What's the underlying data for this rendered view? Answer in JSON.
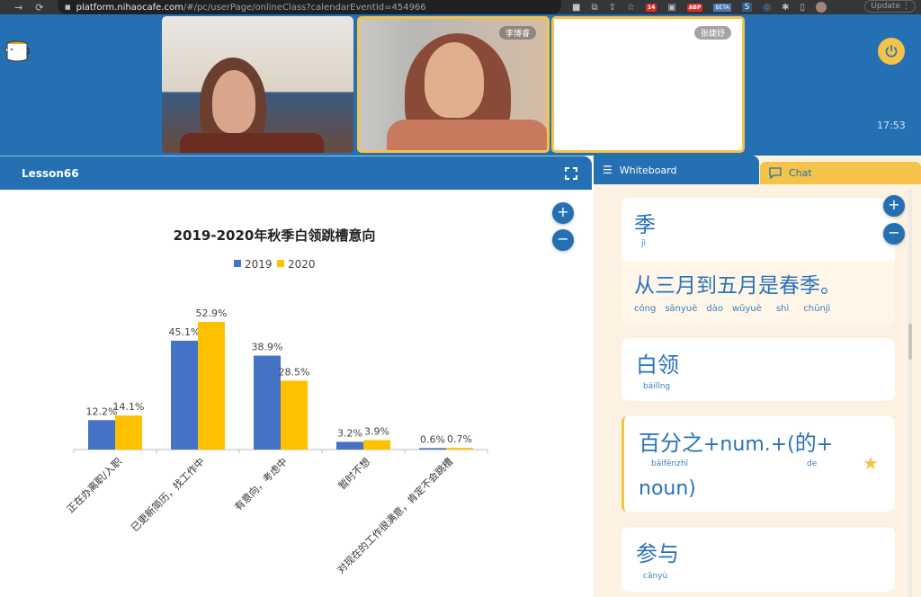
{
  "browser": {
    "url_host": "platform.nihaocafe.com",
    "url_path": "/#/pc/userPage/onlineClass?calendarEventId=454966",
    "back_icon": "←",
    "forward_icon": "→",
    "reload_icon": "⟳",
    "lock_icon": "🔒",
    "extensions": [
      {
        "name": "camera-icon",
        "glyph": "■"
      },
      {
        "name": "translate-icon",
        "glyph": "⧉"
      },
      {
        "name": "share-icon",
        "glyph": "⇪"
      },
      {
        "name": "star-icon",
        "glyph": "☆"
      },
      {
        "name": "calendar-ext-icon",
        "glyph": "14"
      },
      {
        "name": "grid-ext-icon",
        "glyph": "▣"
      },
      {
        "name": "adblock-ext-icon",
        "glyph": "ABP"
      },
      {
        "name": "beta-ext-icon",
        "glyph": "BETA"
      },
      {
        "name": "s-ext-icon",
        "glyph": "S"
      },
      {
        "name": "ring-ext-icon",
        "glyph": "◎"
      },
      {
        "name": "puzzle-icon",
        "glyph": "✱"
      },
      {
        "name": "sidepanel-icon",
        "glyph": "▯"
      }
    ],
    "update_label": "Update",
    "menu_icon": "⋮"
  },
  "topbar": {
    "videos": [
      {
        "name_tag": ""
      },
      {
        "name_tag": "李博睿"
      },
      {
        "name_tag": "张婕妤"
      }
    ],
    "clock": "17:53"
  },
  "lesson": {
    "title": "Lesson66",
    "zoom_in": "+",
    "zoom_out": "−"
  },
  "chart_data": {
    "type": "bar",
    "title": "2019-2020年秋季白领跳槽意向",
    "categories": [
      "正在办离职/入职",
      "已更新简历，找工作中",
      "有意向，考虑中",
      "暂时不想",
      "对现在的工作很满意，肯定不会跳槽"
    ],
    "series": [
      {
        "name": "2019",
        "values": [
          12.2,
          45.1,
          38.9,
          3.2,
          0.6
        ],
        "color": "#4472c4"
      },
      {
        "name": "2020",
        "values": [
          14.1,
          52.9,
          28.5,
          3.9,
          0.7
        ],
        "color": "#ffc000"
      }
    ],
    "data_labels": [
      [
        "12.2%",
        "45.1%",
        "38.9%",
        "3.2%",
        "0.6%"
      ],
      [
        "14.1%",
        "52.9%",
        "28.5%",
        "3.9%",
        "0.7%"
      ]
    ],
    "xlabel": "",
    "ylabel": "",
    "ylim": [
      0,
      60
    ],
    "legend": "top-center",
    "grid": false
  },
  "right_panel": {
    "tabs": {
      "whiteboard": "Whiteboard",
      "chat": "Chat"
    },
    "zoom_in": "+",
    "zoom_out": "−",
    "cards": [
      {
        "word": "季",
        "pinyin": "jì",
        "example": "从三月到五月是春季。",
        "example_pinyin": [
          "cóng",
          "sānyuè",
          "dào",
          "wǔyuè",
          "shì",
          "chūnjì"
        ]
      },
      {
        "word": "白领",
        "pinyin": "báilǐng"
      },
      {
        "word_a": "百分之",
        "word_b": "+num.+(",
        "word_c": "的",
        "word_d": "+",
        "word_e": "noun)",
        "pinyin_a": "bǎifēnzhī",
        "pinyin_c": "de",
        "starred": true
      },
      {
        "word": "参与",
        "pinyin": "cānyù"
      }
    ]
  },
  "colors": {
    "brand_blue": "#2470b3",
    "accent_yellow": "#f5c24a",
    "panel_cream": "#fdf2e2"
  }
}
